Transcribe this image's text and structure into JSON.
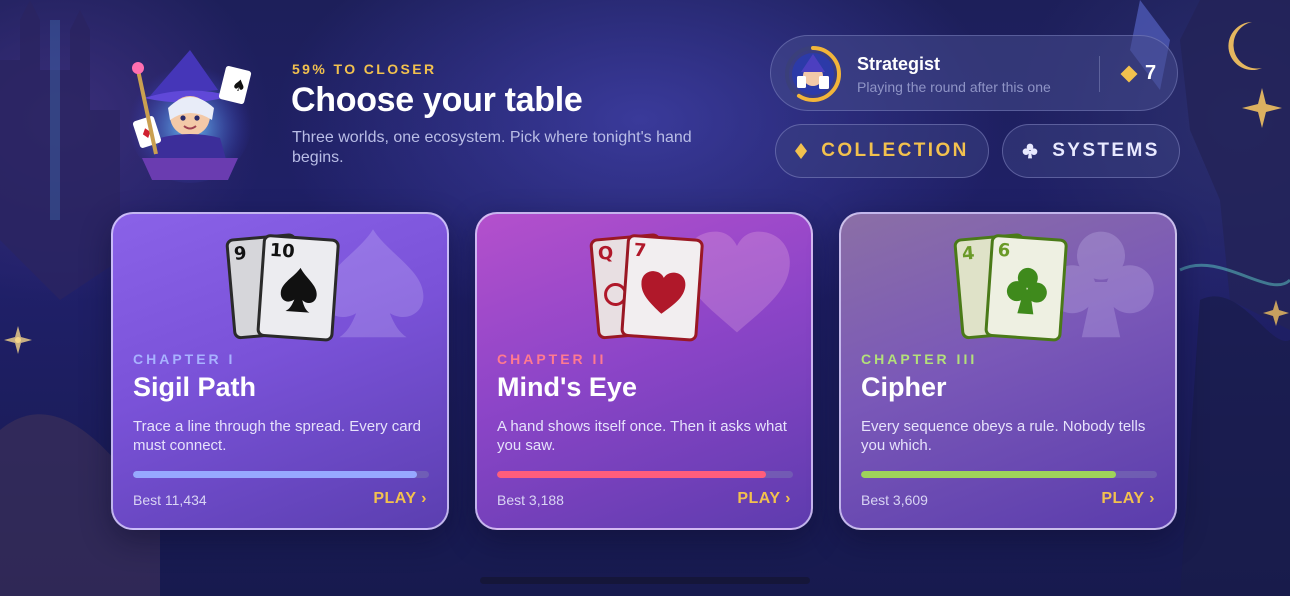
{
  "header": {
    "progress_label": "59% TO CLOSER",
    "title": "Choose your table",
    "subtitle": "Three worlds, one ecosystem. Pick where tonight's hand begins."
  },
  "profile": {
    "rank": "Strategist",
    "status": "Playing the round after this one",
    "gems": "7",
    "rank_progress": 0.59
  },
  "nav": {
    "collection_label": "COLLECTION",
    "systems_label": "SYSTEMS"
  },
  "cards": [
    {
      "chapter": "CHAPTER I",
      "title": "Sigil Path",
      "description": "Trace a line through the spread. Every card must connect.",
      "progress": 0.96,
      "best": "Best 11,434",
      "play": "PLAY ›",
      "suit": "spade",
      "card_ranks": [
        "9",
        "10"
      ],
      "accent": "#97a8ff"
    },
    {
      "chapter": "CHAPTER II",
      "title": "Mind's Eye",
      "description": "A hand shows itself once. Then it asks what you saw.",
      "progress": 0.91,
      "best": "Best 3,188",
      "play": "PLAY ›",
      "suit": "heart",
      "card_ranks": [
        "Q",
        "7"
      ],
      "accent": "#ff5d7c"
    },
    {
      "chapter": "CHAPTER III",
      "title": "Cipher",
      "description": "Every sequence obeys a rule. Nobody tells you which.",
      "progress": 0.86,
      "best": "Best 3,609",
      "play": "PLAY ›",
      "suit": "club",
      "card_ranks": [
        "4",
        "6"
      ],
      "accent": "#9fd35a"
    }
  ],
  "colors": {
    "gold": "#f2c14e",
    "background": "#1d1f5a"
  }
}
